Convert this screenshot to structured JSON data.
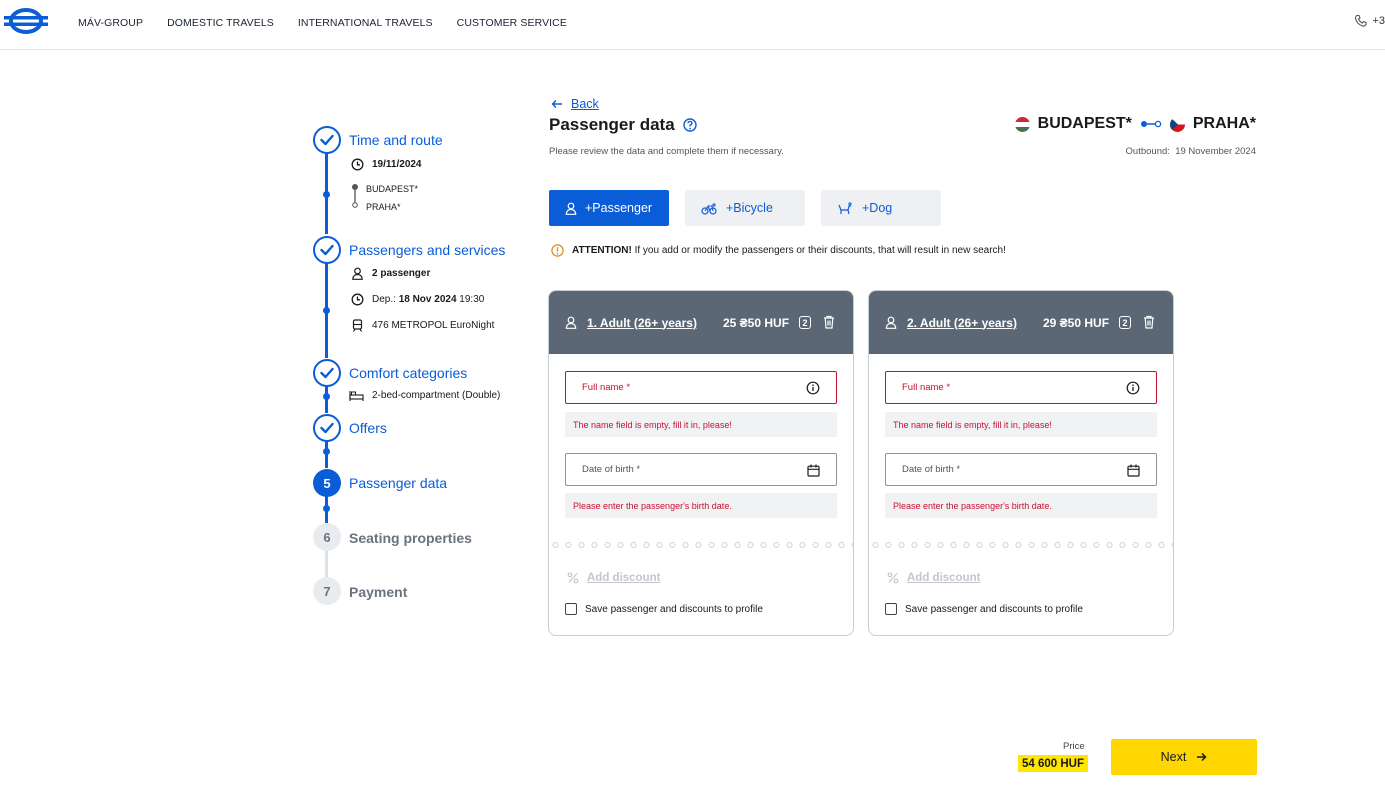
{
  "nav": {
    "links": [
      "MÁV-GROUP",
      "DOMESTIC TRAVELS",
      "INTERNATIONAL TRAVELS",
      "CUSTOMER SERVICE"
    ],
    "phone_partial": "+3"
  },
  "stepper": {
    "steps": [
      {
        "number": "1",
        "title": "Time and route",
        "state": "done"
      },
      {
        "number": "2",
        "title": "Passengers and services",
        "state": "done"
      },
      {
        "number": "3",
        "title": "Comfort categories",
        "state": "done"
      },
      {
        "number": "4",
        "title": "Offers",
        "state": "done"
      },
      {
        "number": "5",
        "title": "Passenger data",
        "state": "active"
      },
      {
        "number": "6",
        "title": "Seating properties",
        "state": "todo"
      },
      {
        "number": "7",
        "title": "Payment",
        "state": "todo"
      }
    ],
    "route_date": "19/11/2024",
    "route_from": "BUDAPEST*",
    "route_to": "PRAHA*",
    "passengers": "2 passenger",
    "dep_label": "Dep.:",
    "dep_date": "18 Nov 2024",
    "dep_time": "19:30",
    "train": "476 METROPOL EuroNight",
    "comfort": "2-bed-compartment (Double)"
  },
  "header": {
    "back": "Back",
    "title": "Passenger data",
    "subtitle": "Please review the data and complete them if necessary.",
    "from": "BUDAPEST*",
    "to": "PRAHA*",
    "outbound_label": "Outbound:",
    "outbound_date": "19 November 2024"
  },
  "add_buttons": {
    "passenger": "+Passenger",
    "bicycle": "+Bicycle",
    "dog": "+Dog"
  },
  "attention": {
    "label": "ATTENTION!",
    "text": "If you add or modify the passengers or their discounts, that will result in new search!"
  },
  "cards": [
    {
      "title": "1. Adult (26+ years)",
      "price": "25 ₴50 HUF",
      "count": "2",
      "name_placeholder": "Full name *",
      "name_error": "The name field is empty, fill it in, please!",
      "dob_placeholder": "Date of birth *",
      "dob_error": "Please enter the passenger's birth date.",
      "add_discount": "Add discount",
      "save_label": "Save passenger and discounts to profile"
    },
    {
      "title": "2. Adult (26+ years)",
      "price": "29 ₴50 HUF",
      "count": "2",
      "name_placeholder": "Full name *",
      "name_error": "The name field is empty, fill it in, please!",
      "dob_placeholder": "Date of birth *",
      "dob_error": "Please enter the passenger's birth date.",
      "add_discount": "Add discount",
      "save_label": "Save passenger and discounts to profile"
    }
  ],
  "footer": {
    "price_label": "Price",
    "price_value": "54 600  HUF",
    "next": "Next"
  },
  "colors": {
    "primary": "#0b5cd7",
    "card_header": "#5b6775",
    "error": "#c8102e",
    "cta": "#ffd600",
    "highlight": "#ffe600"
  }
}
